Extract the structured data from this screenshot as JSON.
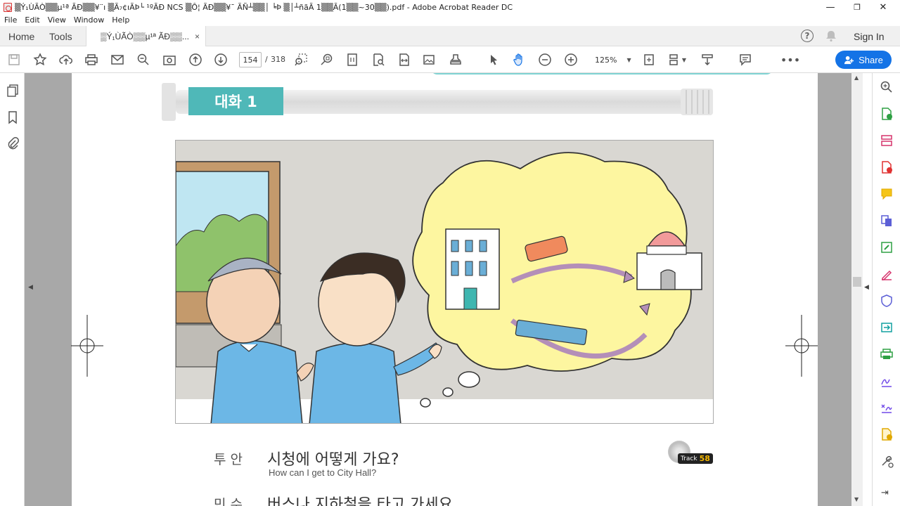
{
  "window": {
    "title": "▒Ý₁ÙÃÒ▒▒µ¹ª ÃÐ▒▒¥¨ı ▒Ã₇¢ıÃÞ└ ¹ºÃÐ NCS ▒Ô¦ ÃÐ▒▒¥¯ ÃÑ┴▒▒│ ╘Þ ▒│┴ñãÃ 1▒▒Ã(1▒▒~30▒▒).pdf - Adobe Acrobat Reader DC",
    "minimize": "—",
    "maximize": "❐",
    "close": "✕"
  },
  "menu": [
    "File",
    "Edit",
    "View",
    "Window",
    "Help"
  ],
  "tabs": {
    "home": "Home",
    "tools": "Tools",
    "doc": "▒Ý₁ÙÃÒ▒▒µ¹ª ÃÐ▒▒...",
    "doc_close": "×"
  },
  "header_right": {
    "help": "?",
    "sign_in": "Sign In"
  },
  "toolbar": {
    "page_current": "154",
    "page_sep": "/",
    "page_total": "318",
    "zoom": "125%",
    "share": "Share"
  },
  "page": {
    "heading": "대화 1",
    "track_label": "Track",
    "track_number": "58",
    "lines": [
      {
        "speaker": "투 안",
        "korean": "시청에 어떻게 가요?",
        "english": "How can I get to City Hall?"
      },
      {
        "speaker": "민 수",
        "korean": "버스나 지하철을 타고 가세요"
      }
    ]
  },
  "colors": {
    "accent": "#1473e6",
    "heading_teal": "#4fb8b8",
    "thought_yellow": "#fdf6a0"
  }
}
